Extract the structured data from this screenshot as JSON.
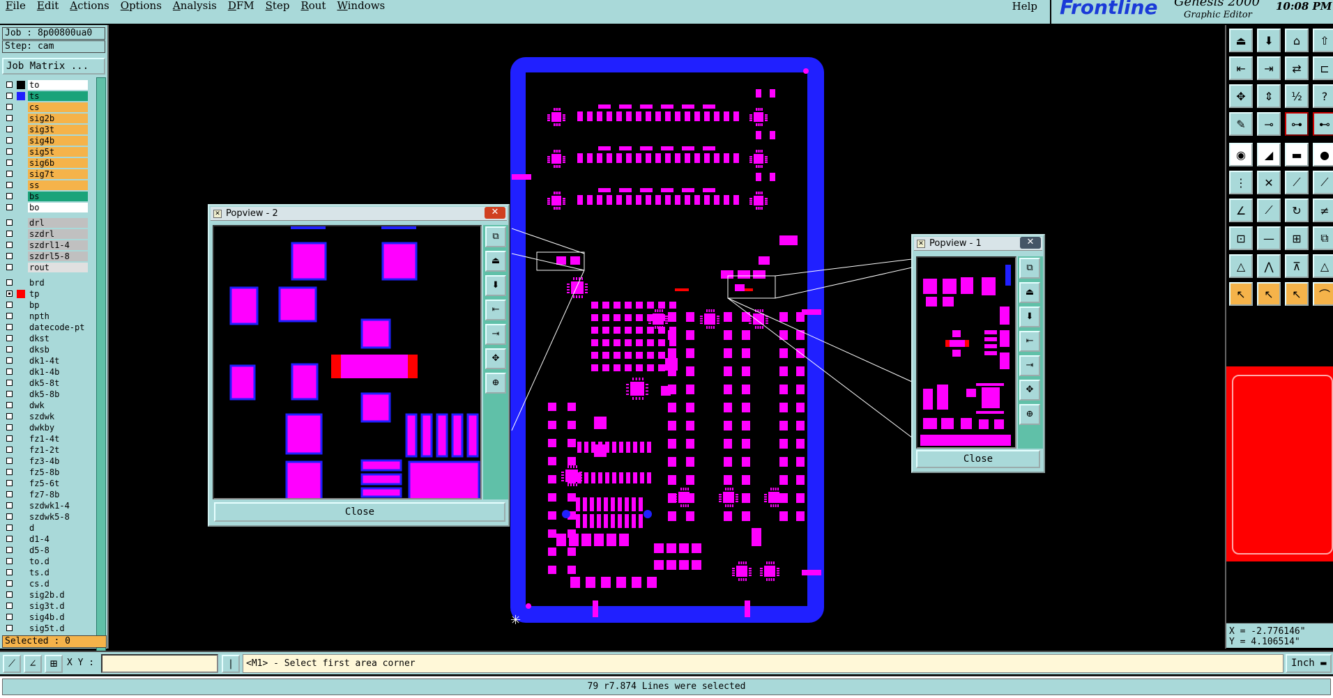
{
  "menu": {
    "items": [
      "File",
      "Edit",
      "Actions",
      "Options",
      "Analysis",
      "DFM",
      "Step",
      "Rout",
      "Windows"
    ],
    "help": "Help"
  },
  "brand": {
    "logo": "Frontline",
    "product": "Genesis 2000",
    "module": "Graphic Editor",
    "time": "10:08 PM"
  },
  "job": {
    "job": "Job : 8p00800ua0",
    "step": "Step: cam",
    "matrix_button": "Job Matrix ..."
  },
  "layers": [
    {
      "name": "to",
      "bg": "#ffffff",
      "sw": "#000000",
      "checked": false
    },
    {
      "name": "ts",
      "bg": "#1aa37a",
      "sw": "#2020ff",
      "checked": false
    },
    {
      "name": "cs",
      "bg": "#f5b34a",
      "sw": "",
      "checked": false
    },
    {
      "name": "sig2b",
      "bg": "#f5b34a",
      "sw": "",
      "checked": false
    },
    {
      "name": "sig3t",
      "bg": "#f5b34a",
      "sw": "",
      "checked": false
    },
    {
      "name": "sig4b",
      "bg": "#f5b34a",
      "sw": "",
      "checked": false
    },
    {
      "name": "sig5t",
      "bg": "#f5b34a",
      "sw": "",
      "checked": false
    },
    {
      "name": "sig6b",
      "bg": "#f5b34a",
      "sw": "",
      "checked": false
    },
    {
      "name": "sig7t",
      "bg": "#f5b34a",
      "sw": "",
      "checked": false
    },
    {
      "name": "ss",
      "bg": "#f5b34a",
      "sw": "",
      "checked": false
    },
    {
      "name": "bs",
      "bg": "#1aa37a",
      "sw": "",
      "checked": false
    },
    {
      "name": "bo",
      "bg": "#ffffff",
      "sw": "",
      "checked": false
    },
    {
      "name": "drl",
      "bg": "#c0c0c0",
      "sw": "",
      "checked": false,
      "gap": true
    },
    {
      "name": "szdrl",
      "bg": "#c0c0c0",
      "sw": "",
      "checked": false
    },
    {
      "name": "szdrl1-4",
      "bg": "#c0c0c0",
      "sw": "",
      "checked": false
    },
    {
      "name": "szdrl5-8",
      "bg": "#c0c0c0",
      "sw": "",
      "checked": false
    },
    {
      "name": "rout",
      "bg": "#e0e0e0",
      "sw": "",
      "checked": false
    },
    {
      "name": "brd",
      "bg": "#a9d9d9",
      "sw": "",
      "checked": false,
      "gap": true
    },
    {
      "name": "tp",
      "bg": "#a9d9d9",
      "sw": "#ff0000",
      "checked": true
    },
    {
      "name": "bp",
      "bg": "#a9d9d9",
      "sw": "",
      "checked": false
    },
    {
      "name": "npth",
      "bg": "#a9d9d9",
      "sw": "",
      "checked": false
    },
    {
      "name": "datecode-pt",
      "bg": "#a9d9d9",
      "sw": "",
      "checked": false
    },
    {
      "name": "dkst",
      "bg": "#a9d9d9",
      "sw": "",
      "checked": false
    },
    {
      "name": "dksb",
      "bg": "#a9d9d9",
      "sw": "",
      "checked": false
    },
    {
      "name": "dk1-4t",
      "bg": "#a9d9d9",
      "sw": "",
      "checked": false
    },
    {
      "name": "dk1-4b",
      "bg": "#a9d9d9",
      "sw": "",
      "checked": false
    },
    {
      "name": "dk5-8t",
      "bg": "#a9d9d9",
      "sw": "",
      "checked": false
    },
    {
      "name": "dk5-8b",
      "bg": "#a9d9d9",
      "sw": "",
      "checked": false
    },
    {
      "name": "dwk",
      "bg": "#a9d9d9",
      "sw": "",
      "checked": false
    },
    {
      "name": "szdwk",
      "bg": "#a9d9d9",
      "sw": "",
      "checked": false
    },
    {
      "name": "dwkby",
      "bg": "#a9d9d9",
      "sw": "",
      "checked": false
    },
    {
      "name": "fz1-4t",
      "bg": "#a9d9d9",
      "sw": "",
      "checked": false
    },
    {
      "name": "fz1-2t",
      "bg": "#a9d9d9",
      "sw": "",
      "checked": false
    },
    {
      "name": "fz3-4b",
      "bg": "#a9d9d9",
      "sw": "",
      "checked": false
    },
    {
      "name": "fz5-8b",
      "bg": "#a9d9d9",
      "sw": "",
      "checked": false
    },
    {
      "name": "fz5-6t",
      "bg": "#a9d9d9",
      "sw": "",
      "checked": false
    },
    {
      "name": "fz7-8b",
      "bg": "#a9d9d9",
      "sw": "",
      "checked": false
    },
    {
      "name": "szdwk1-4",
      "bg": "#a9d9d9",
      "sw": "",
      "checked": false
    },
    {
      "name": "szdwk5-8",
      "bg": "#a9d9d9",
      "sw": "",
      "checked": false
    },
    {
      "name": "d",
      "bg": "#a9d9d9",
      "sw": "",
      "checked": false
    },
    {
      "name": "d1-4",
      "bg": "#a9d9d9",
      "sw": "",
      "checked": false
    },
    {
      "name": "d5-8",
      "bg": "#a9d9d9",
      "sw": "",
      "checked": false
    },
    {
      "name": "to.d",
      "bg": "#a9d9d9",
      "sw": "",
      "checked": false
    },
    {
      "name": "ts.d",
      "bg": "#a9d9d9",
      "sw": "",
      "checked": false
    },
    {
      "name": "cs.d",
      "bg": "#a9d9d9",
      "sw": "",
      "checked": false
    },
    {
      "name": "sig2b.d",
      "bg": "#a9d9d9",
      "sw": "",
      "checked": false
    },
    {
      "name": "sig3t.d",
      "bg": "#a9d9d9",
      "sw": "",
      "checked": false
    },
    {
      "name": "sig4b.d",
      "bg": "#a9d9d9",
      "sw": "",
      "checked": false
    },
    {
      "name": "sig5t.d",
      "bg": "#a9d9d9",
      "sw": "",
      "checked": false
    }
  ],
  "selected": "Selected : 0",
  "popview2": {
    "title": "Popview - 2",
    "close": "Close"
  },
  "popview1": {
    "title": "Popview - 1",
    "close": "Close"
  },
  "coords": {
    "x": "X = -2.776146\"",
    "y": "Y = 4.106514\""
  },
  "command": {
    "xy_label": "X Y :",
    "xy_value": "",
    "prompt": "<M1> - Select first area corner",
    "units": "Inch"
  },
  "status": "79 r7.874 Lines were selected",
  "colors": {
    "pad": "#ff00ff",
    "board": "#2020ff",
    "panel": "#a9d9d9",
    "highlight": "#ff0000"
  }
}
